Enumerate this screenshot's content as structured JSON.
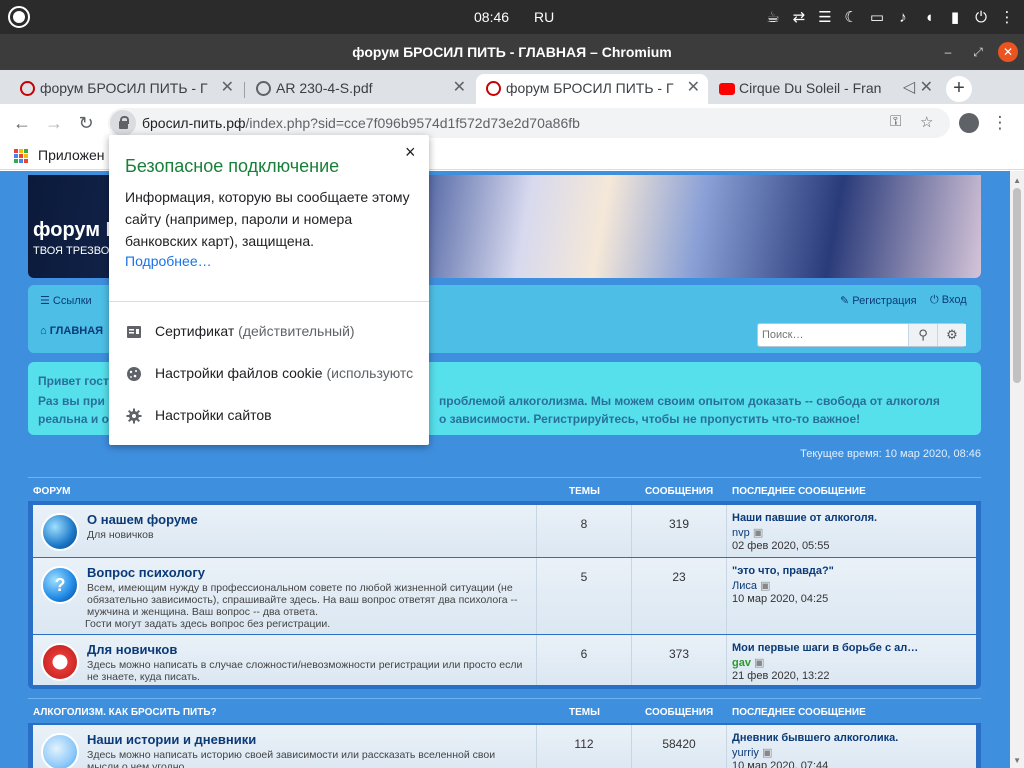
{
  "os": {
    "time": "08:46",
    "lang": "RU"
  },
  "window": {
    "title": "форум БРОСИЛ ПИТЬ - ГЛАВНАЯ – Chromium"
  },
  "tabs": [
    {
      "label": "форум БРОСИЛ ПИТЬ - Г",
      "active": false
    },
    {
      "label": "AR 230-4-S.pdf",
      "active": false
    },
    {
      "label": "форум БРОСИЛ ПИТЬ - Г",
      "active": true
    },
    {
      "label": "Cirque Du Soleil - Fran",
      "active": false
    }
  ],
  "address": {
    "host": "бросил-пить.рф",
    "path": "/index.php?sid=cce7f096b9574d1f572d73e2d70a86fb"
  },
  "bookmarks": {
    "apps_label": "Приложен"
  },
  "site": {
    "banner_title": "форум I",
    "banner_sub": "ТВОЯ ТРЕЗВО",
    "nav_links": "Ссылки",
    "nav_faq_tail": "ТЬ",
    "nav_register": "Регистрация",
    "nav_login": "Вход",
    "breadcrumb_home": "ГЛАВНАЯ",
    "search_placeholder": "Поиск…",
    "welcome_line1": "Привет гост",
    "welcome_line2_left": "Раз вы при",
    "welcome_line2_right": "проблемой алкоголизма. Мы можем своим опытом доказать -- свобода от алкоголя",
    "welcome_line3_left": "реальна и о",
    "welcome_line3_right": "о зависимости. Регистрируйтесь, чтобы не пропустить что-то важное!",
    "current_time": "Текущее время: 10 мар 2020, 08:46"
  },
  "forum_table": {
    "headers": {
      "forum": "ФОРУМ",
      "topics": "ТЕМЫ",
      "posts": "СООБЩЕНИЯ",
      "last": "ПОСЛЕДНЕЕ СООБЩЕНИЕ"
    },
    "rows": [
      {
        "title": "О нашем форуме",
        "desc": "Для новичков",
        "topics": "8",
        "posts": "319",
        "last_title": "Наши павшие от алкоголя.",
        "last_author": "nvp",
        "last_date": "02 фев 2020, 05:55",
        "icon": "globe-icon"
      },
      {
        "title": "Вопрос психологу",
        "desc": "Всем, имеющим нужду в профессиональном совете по любой жизненной ситуации (не обязательно зависимость), спрашивайте здесь. На ваш вопрос ответят два психолога -- мужчина и женщина. Ваш вопрос -- два ответа.",
        "desc2": "Гости могут задать здесь вопрос без регистрации.",
        "topics": "5",
        "posts": "23",
        "last_title": "\"это что, правда?\"",
        "last_author": "Лиса",
        "last_date": "10 мар 2020, 04:25",
        "icon": "question-icon"
      },
      {
        "title": "Для новичков",
        "desc": "Здесь можно написать в случае сложности/невозможности регистрации или просто если не знаете, куда писать.",
        "topics": "6",
        "posts": "373",
        "last_title": "Мои первые шаги в борьбе с ал…",
        "last_author": "gav",
        "last_date": "21 фев 2020, 13:22",
        "icon": "lifebuoy-icon"
      }
    ]
  },
  "forum_table2": {
    "headers": {
      "forum": "АЛКОГОЛИЗМ. КАК БРОСИТЬ ПИТЬ?",
      "topics": "ТЕМЫ",
      "posts": "СООБЩЕНИЯ",
      "last": "ПОСЛЕДНЕЕ СООБЩЕНИЕ"
    },
    "rows": [
      {
        "title": "Наши истории и дневники",
        "desc": "Здесь можно написать историю своей зависимости или рассказать вселенной свои мысли о чем угодно",
        "topics": "112",
        "posts": "58420",
        "last_title": "Дневник бывшего алкоголика.",
        "last_author": "yurriy",
        "last_date": "10 мар 2020, 07:44",
        "icon": "feather-icon"
      }
    ]
  },
  "popup": {
    "title": "Безопасное подключение",
    "desc": "Информация, которую вы сообщаете этому сайту (например, пароли и номера банковских карт), защищена.",
    "more": "Подробнее…",
    "items": [
      {
        "label": "Сертификат",
        "muted": " (действительный)",
        "icon": "certificate-icon"
      },
      {
        "label": "Настройки файлов cookie",
        "muted": " (используются)",
        "icon": "cookie-icon"
      },
      {
        "label": "Настройки сайтов",
        "muted": "",
        "icon": "gear-icon"
      }
    ],
    "close": "×"
  },
  "colors": {
    "accent_green": "#188038",
    "link_blue": "#1a73e8",
    "page_blue": "#3f8fdf",
    "welcome_cyan": "#56e0ec"
  }
}
